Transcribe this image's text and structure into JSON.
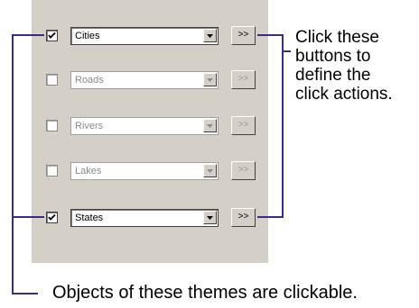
{
  "themes": [
    {
      "name": "Cities",
      "checked": true,
      "enabled": true,
      "action_label": ">>"
    },
    {
      "name": "Roads",
      "checked": false,
      "enabled": false,
      "action_label": ">>"
    },
    {
      "name": "Rivers",
      "checked": false,
      "enabled": false,
      "action_label": ">>"
    },
    {
      "name": "Lakes",
      "checked": false,
      "enabled": false,
      "action_label": ">>"
    },
    {
      "name": "States",
      "checked": true,
      "enabled": true,
      "action_label": ">>"
    }
  ],
  "annotations": {
    "click_buttons": [
      "Click these",
      "buttons to",
      "define the",
      "click actions."
    ],
    "clickable_themes": "Objects of these themes are clickable."
  },
  "colors": {
    "panel": "#d4d0c8",
    "connector": "#3b2a8a"
  }
}
